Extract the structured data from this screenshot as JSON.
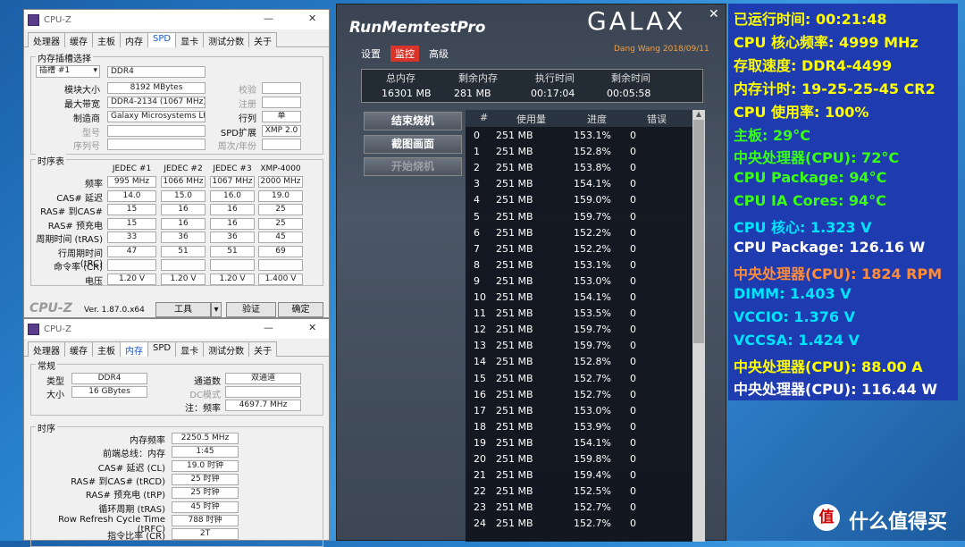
{
  "cpuz_spd": {
    "title": "CPU-Z",
    "tabs": [
      "处理器",
      "缓存",
      "主板",
      "内存",
      "SPD",
      "显卡",
      "测试分数",
      "关于"
    ],
    "active": "SPD",
    "slot_group": "内存插槽选择",
    "slot": "插槽 #1",
    "type": "DDR4",
    "module_size_label": "模块大小",
    "module_size": "8192 MBytes",
    "max_bw_label": "最大带宽",
    "max_bw": "DDR4-2134 (1067 MHz)",
    "maker_label": "制造商",
    "maker": "Galaxy Microsystems Ltd.",
    "model_label": "型号",
    "serial_label": "序列号",
    "check_label": "校验",
    "reg_label": "注册",
    "rank_label": "行列",
    "rank": "单",
    "spd_ext_label": "SPD扩展",
    "spd_ext": "XMP 2.0",
    "week_label": "周次/年份",
    "timing_group": "时序表",
    "cols": [
      "JEDEC #1",
      "JEDEC #2",
      "JEDEC #3",
      "XMP-4000"
    ],
    "rows": [
      {
        "label": "频率",
        "vals": [
          "995 MHz",
          "1066 MHz",
          "1067 MHz",
          "2000 MHz"
        ]
      },
      {
        "label": "CAS# 延迟",
        "vals": [
          "14.0",
          "15.0",
          "16.0",
          "19.0"
        ]
      },
      {
        "label": "RAS# 到CAS#",
        "vals": [
          "15",
          "16",
          "16",
          "25"
        ]
      },
      {
        "label": "RAS# 预充电",
        "vals": [
          "15",
          "16",
          "16",
          "25"
        ]
      },
      {
        "label": "周期时间 (tRAS)",
        "vals": [
          "33",
          "36",
          "36",
          "45"
        ]
      },
      {
        "label": "行周期时间 (tRC)",
        "vals": [
          "47",
          "51",
          "51",
          "69"
        ]
      },
      {
        "label": "命令率 (CR)",
        "vals": [
          "",
          "",
          "",
          ""
        ]
      },
      {
        "label": "电压",
        "vals": [
          "1.20 V",
          "1.20 V",
          "1.20 V",
          "1.400 V"
        ]
      }
    ],
    "logo": "CPU-Z",
    "version": "Ver. 1.87.0.x64",
    "tools": "工具",
    "validate": "验证",
    "ok": "确定"
  },
  "cpuz_mem": {
    "title": "CPU-Z",
    "tabs": [
      "处理器",
      "缓存",
      "主板",
      "内存",
      "SPD",
      "显卡",
      "测试分数",
      "关于"
    ],
    "active": "内存",
    "general": "常规",
    "type_label": "类型",
    "type": "DDR4",
    "size_label": "大小",
    "size": "16 GBytes",
    "ch_label": "通道数",
    "ch": "双通道",
    "dc_label": "DC模式",
    "nb_label": "注：频率",
    "nb": "4697.7 MHz",
    "timing": "时序",
    "rows": [
      {
        "label": "内存频率",
        "val": "2250.5 MHz"
      },
      {
        "label": "前端总线：内存",
        "val": "1:45"
      },
      {
        "label": "CAS# 延迟 (CL)",
        "val": "19.0 时钟"
      },
      {
        "label": "RAS# 到CAS# (tRCD)",
        "val": "25 时钟"
      },
      {
        "label": "RAS# 预充电 (tRP)",
        "val": "25 时钟"
      },
      {
        "label": "循环周期 (tRAS)",
        "val": "45 时钟"
      },
      {
        "label": "Row Refresh Cycle Time (tRFC)",
        "val": "788 时钟"
      },
      {
        "label": "指令比率 (CR)",
        "val": "2T"
      }
    ]
  },
  "memtest": {
    "title": "RunMemtestPro",
    "brand": "GALAX",
    "credit": "Dang Wang 2018/09/11",
    "menu": [
      "设置",
      "监控",
      "高级"
    ],
    "menu_active": "监控",
    "sum_heads": [
      "总内存",
      "剩余内存",
      "执行时间",
      "剩余时间"
    ],
    "sum_vals": [
      "16301 MB",
      "281 MB",
      "00:17:04",
      "00:05:58"
    ],
    "buttons": [
      "结束烧机",
      "截图画面",
      "开始烧机"
    ],
    "cols": [
      "#",
      "使用量",
      "进度",
      "错误"
    ],
    "rows": [
      [
        "0",
        "251 MB",
        "153.1%",
        "0"
      ],
      [
        "1",
        "251 MB",
        "152.8%",
        "0"
      ],
      [
        "2",
        "251 MB",
        "153.8%",
        "0"
      ],
      [
        "3",
        "251 MB",
        "154.1%",
        "0"
      ],
      [
        "4",
        "251 MB",
        "159.0%",
        "0"
      ],
      [
        "5",
        "251 MB",
        "159.7%",
        "0"
      ],
      [
        "6",
        "251 MB",
        "152.2%",
        "0"
      ],
      [
        "7",
        "251 MB",
        "152.2%",
        "0"
      ],
      [
        "8",
        "251 MB",
        "153.1%",
        "0"
      ],
      [
        "9",
        "251 MB",
        "153.0%",
        "0"
      ],
      [
        "10",
        "251 MB",
        "154.1%",
        "0"
      ],
      [
        "11",
        "251 MB",
        "153.5%",
        "0"
      ],
      [
        "12",
        "251 MB",
        "159.7%",
        "0"
      ],
      [
        "13",
        "251 MB",
        "159.7%",
        "0"
      ],
      [
        "14",
        "251 MB",
        "152.8%",
        "0"
      ],
      [
        "15",
        "251 MB",
        "152.7%",
        "0"
      ],
      [
        "16",
        "251 MB",
        "152.7%",
        "0"
      ],
      [
        "17",
        "251 MB",
        "153.0%",
        "0"
      ],
      [
        "18",
        "251 MB",
        "153.9%",
        "0"
      ],
      [
        "19",
        "251 MB",
        "154.1%",
        "0"
      ],
      [
        "20",
        "251 MB",
        "159.8%",
        "0"
      ],
      [
        "21",
        "251 MB",
        "159.4%",
        "0"
      ],
      [
        "22",
        "251 MB",
        "152.5%",
        "0"
      ],
      [
        "23",
        "251 MB",
        "152.7%",
        "0"
      ],
      [
        "24",
        "251 MB",
        "152.7%",
        "0"
      ]
    ]
  },
  "overlay": {
    "lines": [
      {
        "text": "已运行时间: 00:21:48",
        "color": "#ffff00"
      },
      {
        "text": "CPU 核心频率: 4999 MHz",
        "color": "#ffff00"
      },
      {
        "text": "存取速度: DDR4-4499",
        "color": "#ffff00"
      },
      {
        "text": "内存计时: 19-25-25-45 CR2",
        "color": "#ffff00"
      },
      {
        "text": "CPU 使用率: 100%",
        "color": "#ffff00"
      },
      {
        "text": "主板: 29°C",
        "color": "#39ff14"
      },
      {
        "text": "中央处理器(CPU): 72°C",
        "color": "#39ff14"
      },
      {
        "text": "CPU Package: 94°C",
        "color": "#39ff14"
      },
      {
        "text": "CPU IA Cores: 94°C",
        "color": "#39ff14"
      },
      {
        "text": "CPU 核心: 1.323 V",
        "color": "#00e5ff"
      },
      {
        "text": "CPU Package: 126.16 W",
        "color": "#ffffff"
      },
      {
        "text": "中央处理器(CPU): 1824 RPM",
        "color": "#ff8c3a"
      },
      {
        "text": "DIMM: 1.403 V",
        "color": "#00e5ff"
      },
      {
        "text": "VCCIO: 1.376 V",
        "color": "#00e5ff"
      },
      {
        "text": "VCCSA: 1.424 V",
        "color": "#00e5ff"
      },
      {
        "text": "中央处理器(CPU): 88.00 A",
        "color": "#ffff00"
      },
      {
        "text": "中央处理器(CPU): 116.44 W",
        "color": "#ffffff"
      }
    ]
  },
  "watermark": {
    "text": "什么值得买",
    "logo": "值"
  }
}
